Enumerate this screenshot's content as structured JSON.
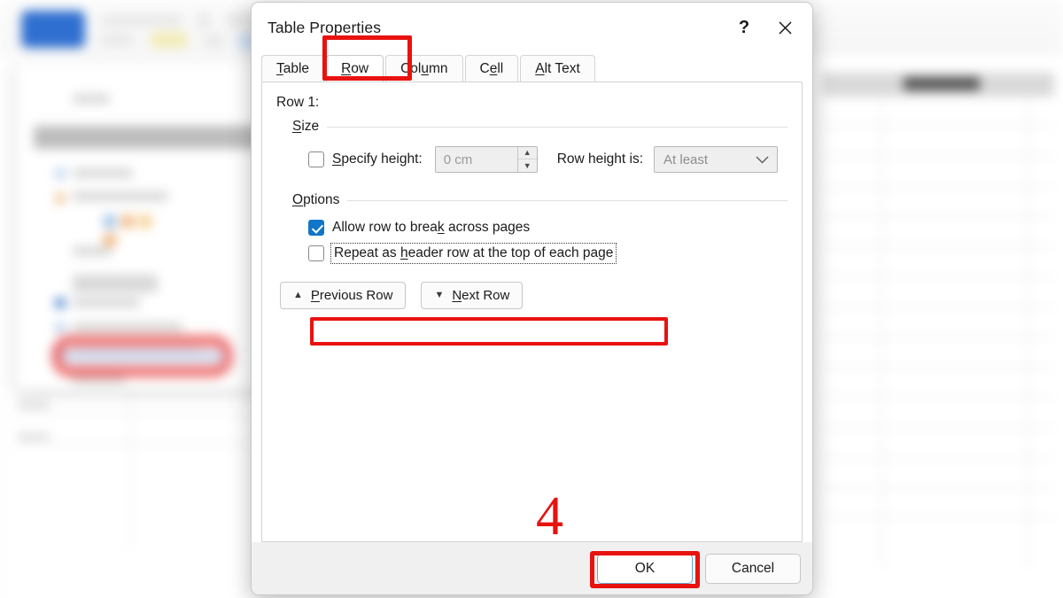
{
  "dialog": {
    "title": "Table Properties",
    "titlebar_buttons": [
      {
        "name": "help-button",
        "label": "?"
      },
      {
        "name": "close-button",
        "label": "✕"
      }
    ],
    "tabs": [
      {
        "label": "Table",
        "mnemonic_before": "",
        "mnemonic": "T",
        "mnemonic_after": "able",
        "active": false
      },
      {
        "label": "Row",
        "mnemonic_before": "",
        "mnemonic": "R",
        "mnemonic_after": "ow",
        "active": true
      },
      {
        "label": "Column",
        "mnemonic_before": "Col",
        "mnemonic": "u",
        "mnemonic_after": "mn",
        "active": false
      },
      {
        "label": "Cell",
        "mnemonic_before": "C",
        "mnemonic": "e",
        "mnemonic_after": "ll",
        "active": false
      },
      {
        "label": "Alt Text",
        "mnemonic_before": "",
        "mnemonic": "A",
        "mnemonic_after": "lt Text",
        "active": false
      }
    ],
    "row_label": "Row 1:",
    "size_group": {
      "legend_before": "",
      "legend_mnemonic": "S",
      "legend_after": "ize",
      "legend": "Size",
      "specify_height": {
        "label": "Specify height:",
        "label_before": "",
        "label_mnemonic": "S",
        "label_after": "pecify height:",
        "checked": false,
        "enabled": true
      },
      "height_value": "0 cm",
      "height_enabled": false,
      "spinner_up": "▲",
      "spinner_down": "▼",
      "row_height_is_label": "Row height is:",
      "row_height_is_value": "At least",
      "row_height_is_enabled": false,
      "dropdown_chevron": "⌄"
    },
    "options_group": {
      "legend": "Options",
      "legend_before": "",
      "legend_mnemonic": "O",
      "legend_after": "ptions",
      "items": [
        {
          "label": "Allow row to break across pages",
          "before": "Allow row to brea",
          "mnemonic": "k",
          "after": " across pages",
          "checked": true,
          "focused": false,
          "highlighted": false
        },
        {
          "label": "Repeat as header row at the top of each page",
          "before": "Repeat as ",
          "mnemonic": "h",
          "after": "eader row at the top of each page",
          "checked": false,
          "focused": true,
          "highlighted": true
        }
      ]
    },
    "nav_buttons": [
      {
        "name": "previous-row-button",
        "icon": "▲",
        "before": "",
        "mnemonic": "P",
        "after": "revious Row",
        "label": "Previous Row"
      },
      {
        "name": "next-row-button",
        "icon": "▼",
        "before": "",
        "mnemonic": "N",
        "after": "ext Row",
        "label": "Next Row"
      }
    ],
    "footer_buttons": [
      {
        "name": "ok-button",
        "label": "OK",
        "default": true,
        "highlighted": true
      },
      {
        "name": "cancel-button",
        "label": "Cancel",
        "default": false,
        "highlighted": false
      }
    ]
  },
  "annotations": {
    "step_number": "4",
    "highlight_color": "#e8120f"
  },
  "colors": {
    "accent": "#1275c8",
    "highlight_red": "#e8120f",
    "default_button_border": "#6ba4d8",
    "footer_bg": "#f0f0f0"
  }
}
